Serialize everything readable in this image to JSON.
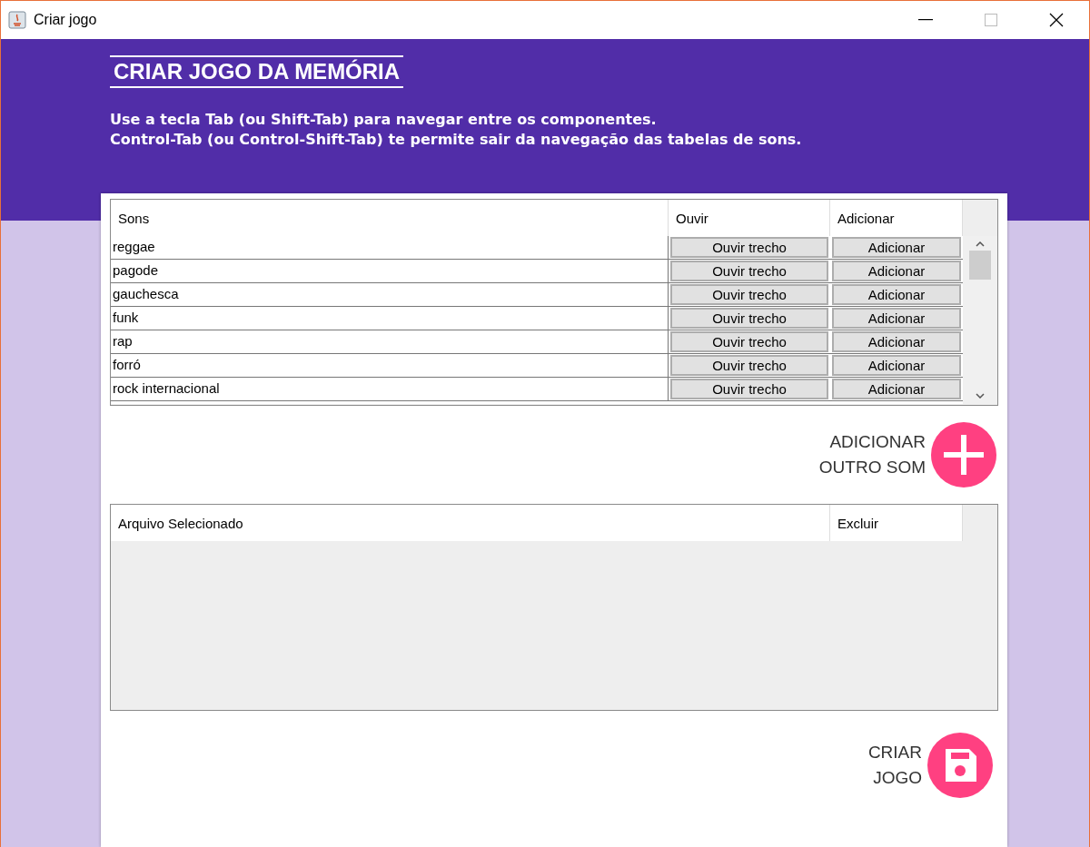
{
  "window": {
    "title": "Criar jogo"
  },
  "header": {
    "title": "CRIAR JOGO DA MEMÓRIA",
    "instructions": [
      "Use a tecla Tab (ou Shift-Tab) para navegar entre os componentes.",
      "Control-Tab (ou Control-Shift-Tab) te permite sair da navegação das tabelas de sons."
    ]
  },
  "sounds_table": {
    "columns": [
      "Sons",
      "Ouvir",
      "Adicionar"
    ],
    "rows": [
      {
        "name": "reggae",
        "listen": "Ouvir trecho",
        "add": "Adicionar"
      },
      {
        "name": "pagode",
        "listen": "Ouvir trecho",
        "add": "Adicionar"
      },
      {
        "name": "gauchesca",
        "listen": "Ouvir trecho",
        "add": "Adicionar"
      },
      {
        "name": "funk",
        "listen": "Ouvir trecho",
        "add": "Adicionar"
      },
      {
        "name": "rap",
        "listen": "Ouvir trecho",
        "add": "Adicionar"
      },
      {
        "name": "forró",
        "listen": "Ouvir trecho",
        "add": "Adicionar"
      },
      {
        "name": "rock internacional",
        "listen": "Ouvir trecho",
        "add": "Adicionar"
      }
    ]
  },
  "add_other_sound": {
    "label": [
      "ADICIONAR",
      "OUTRO SOM"
    ]
  },
  "selected_table": {
    "columns": [
      "Arquivo Selecionado",
      "Excluir"
    ]
  },
  "create_game": {
    "label": [
      "CRIAR",
      "JOGO"
    ]
  }
}
